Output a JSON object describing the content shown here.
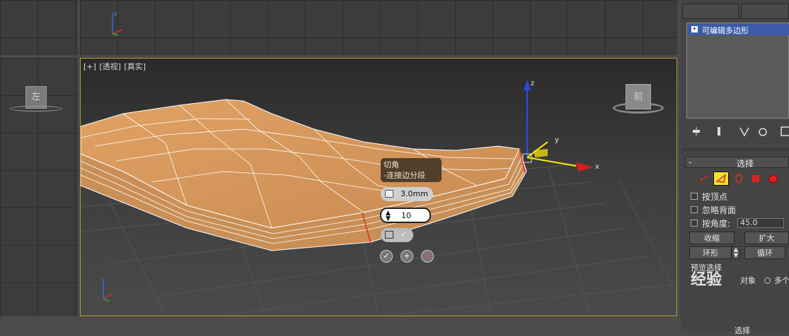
{
  "viewport": {
    "label_parts": [
      "[+]",
      "[透视]",
      "[真实]"
    ],
    "top_left_view_label": "左",
    "viewcube_label": "前"
  },
  "caddy": {
    "title": "切角",
    "subtitle": "-连接边分段",
    "amount_value": "3.0mm",
    "segments_value": "10",
    "ok_icon": "check-icon",
    "apply_icon": "plus-icon",
    "cancel_icon": "x-icon"
  },
  "gizmo": {
    "axis_x": "x",
    "axis_y": "y",
    "axis_z": "z"
  },
  "panel": {
    "modifier_item": "可编辑多边形",
    "selection_rollout_title": "选择",
    "by_vertex": "按顶点",
    "ignore_backfacing": "忽略背面",
    "by_angle": "按角度:",
    "angle_value": "45.0",
    "shrink": "收缩",
    "grow": "扩大",
    "ring": "环形",
    "loop": "循环",
    "preview_selection": "预览选择",
    "object_label": "对象",
    "multi_label": "多个",
    "bottom_partial": "选择",
    "collapse_sign": "-"
  },
  "colors": {
    "viewport_border": "#b89a2a",
    "mesh_fill": "#d89a5c",
    "edge_selected": "#e03020",
    "caddy_bg": "#4a3a28"
  },
  "watermark": "经验"
}
